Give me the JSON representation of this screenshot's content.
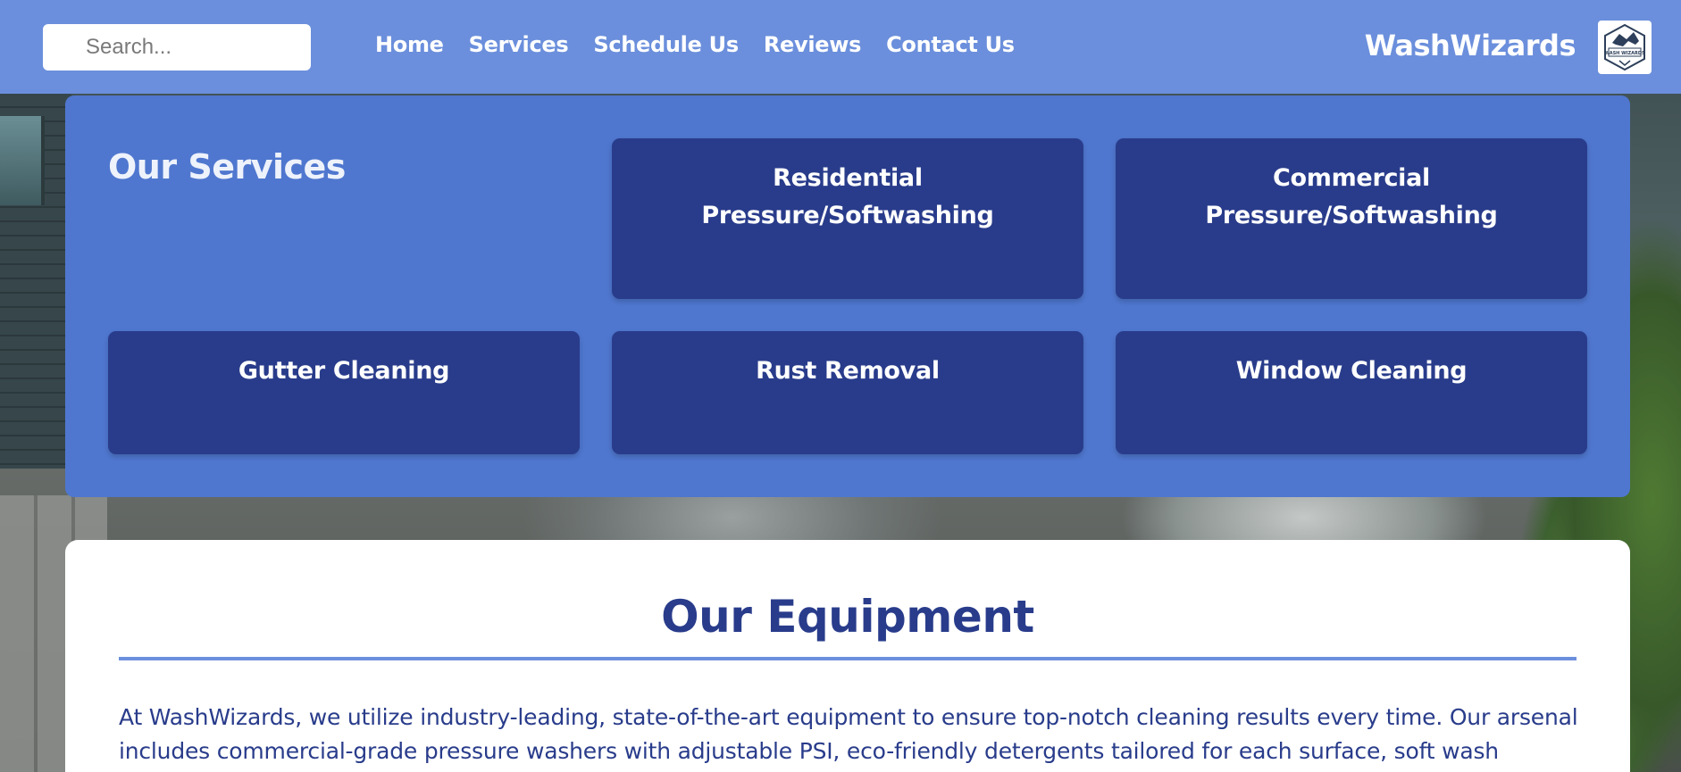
{
  "header": {
    "search_placeholder": "Search...",
    "nav": [
      "Home",
      "Services",
      "Schedule Us",
      "Reviews",
      "Contact Us"
    ],
    "brand": "WashWizards",
    "logo_text": "WASH WIZARDS",
    "bg_color": "#6b8fdc"
  },
  "services": {
    "title": "Our Services",
    "cards": [
      {
        "line1": "Residential",
        "line2": "Pressure/Softwashing"
      },
      {
        "line1": "Commercial",
        "line2": "Pressure/Softwashing"
      },
      {
        "line1": "Gutter Cleaning",
        "line2": ""
      },
      {
        "line1": "Rust Removal",
        "line2": ""
      },
      {
        "line1": "Window Cleaning",
        "line2": ""
      }
    ],
    "panel_color": "#4f77cf",
    "card_color": "#293c8b"
  },
  "equipment": {
    "title": "Our Equipment",
    "body": "At WashWizards, we utilize industry-leading, state-of-the-art equipment to ensure top-notch cleaning results every time. Our arsenal includes commercial-grade pressure washers with adjustable PSI, eco-friendly detergents tailored for each surface, soft wash systems to"
  }
}
